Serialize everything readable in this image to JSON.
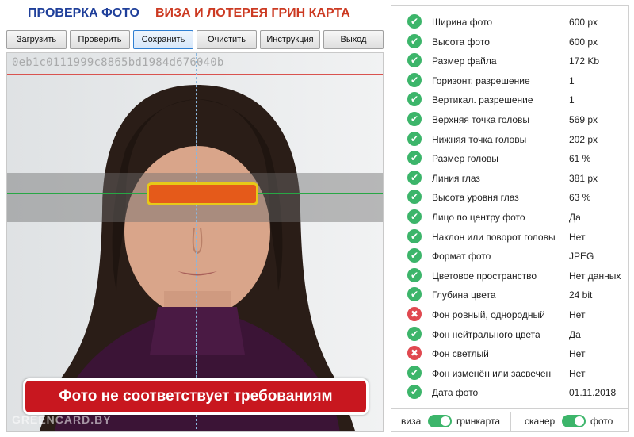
{
  "title": {
    "part1": "ПРОВЕРКА ФОТО",
    "part2": "ВИЗА И ЛОТЕРЕЯ ГРИН КАРТА"
  },
  "toolbar": {
    "load": "Загрузить",
    "check": "Проверить",
    "save": "Сохранить",
    "clear": "Очистить",
    "instructions": "Инструкция",
    "exit": "Выход"
  },
  "photo": {
    "hash": "0eb1c0111999c8865bd1984d676040b",
    "warning": "Фото не соответствует требованиям",
    "watermark": "GREENCARD.BY"
  },
  "checks": [
    {
      "status": "ok",
      "label": "Ширина фото",
      "value": "600 px"
    },
    {
      "status": "ok",
      "label": "Высота фото",
      "value": "600 px"
    },
    {
      "status": "ok",
      "label": "Размер файла",
      "value": "172 Kb"
    },
    {
      "status": "ok",
      "label": "Горизонт. разрешение",
      "value": "1"
    },
    {
      "status": "ok",
      "label": "Вертикал. разрешение",
      "value": "1"
    },
    {
      "status": "ok",
      "label": "Верхняя точка головы",
      "value": "569 px"
    },
    {
      "status": "ok",
      "label": "Нижняя точка головы",
      "value": "202 px"
    },
    {
      "status": "ok",
      "label": "Размер головы",
      "value": "61 %"
    },
    {
      "status": "ok",
      "label": "Линия глаз",
      "value": "381 px"
    },
    {
      "status": "ok",
      "label": "Высота уровня глаз",
      "value": "63 %"
    },
    {
      "status": "ok",
      "label": "Лицо по центру фото",
      "value": "Да"
    },
    {
      "status": "ok",
      "label": "Наклон или поворот головы",
      "value": "Нет"
    },
    {
      "status": "ok",
      "label": "Формат фото",
      "value": "JPEG"
    },
    {
      "status": "ok",
      "label": "Цветовое пространство",
      "value": "Нет данных"
    },
    {
      "status": "ok",
      "label": "Глубина цвета",
      "value": "24 bit"
    },
    {
      "status": "bad",
      "label": "Фон ровный, однородный",
      "value": "Нет"
    },
    {
      "status": "ok",
      "label": "Фон нейтрального цвета",
      "value": "Да"
    },
    {
      "status": "bad",
      "label": "Фон светлый",
      "value": "Нет"
    },
    {
      "status": "ok",
      "label": "Фон изменён или засвечен",
      "value": "Нет"
    },
    {
      "status": "ok",
      "label": "Дата фото",
      "value": "01.11.2018"
    }
  ],
  "footer": {
    "left_off": "виза",
    "left_on": "гринкарта",
    "right_off": "сканер",
    "right_on": "фото"
  },
  "icons": {
    "ok": "check-circle-icon",
    "bad": "x-circle-icon"
  },
  "colors": {
    "ok": "#3cb56a",
    "bad": "#e0484f",
    "warning": "#c8171f",
    "eye_bar": "#e55a1a"
  }
}
